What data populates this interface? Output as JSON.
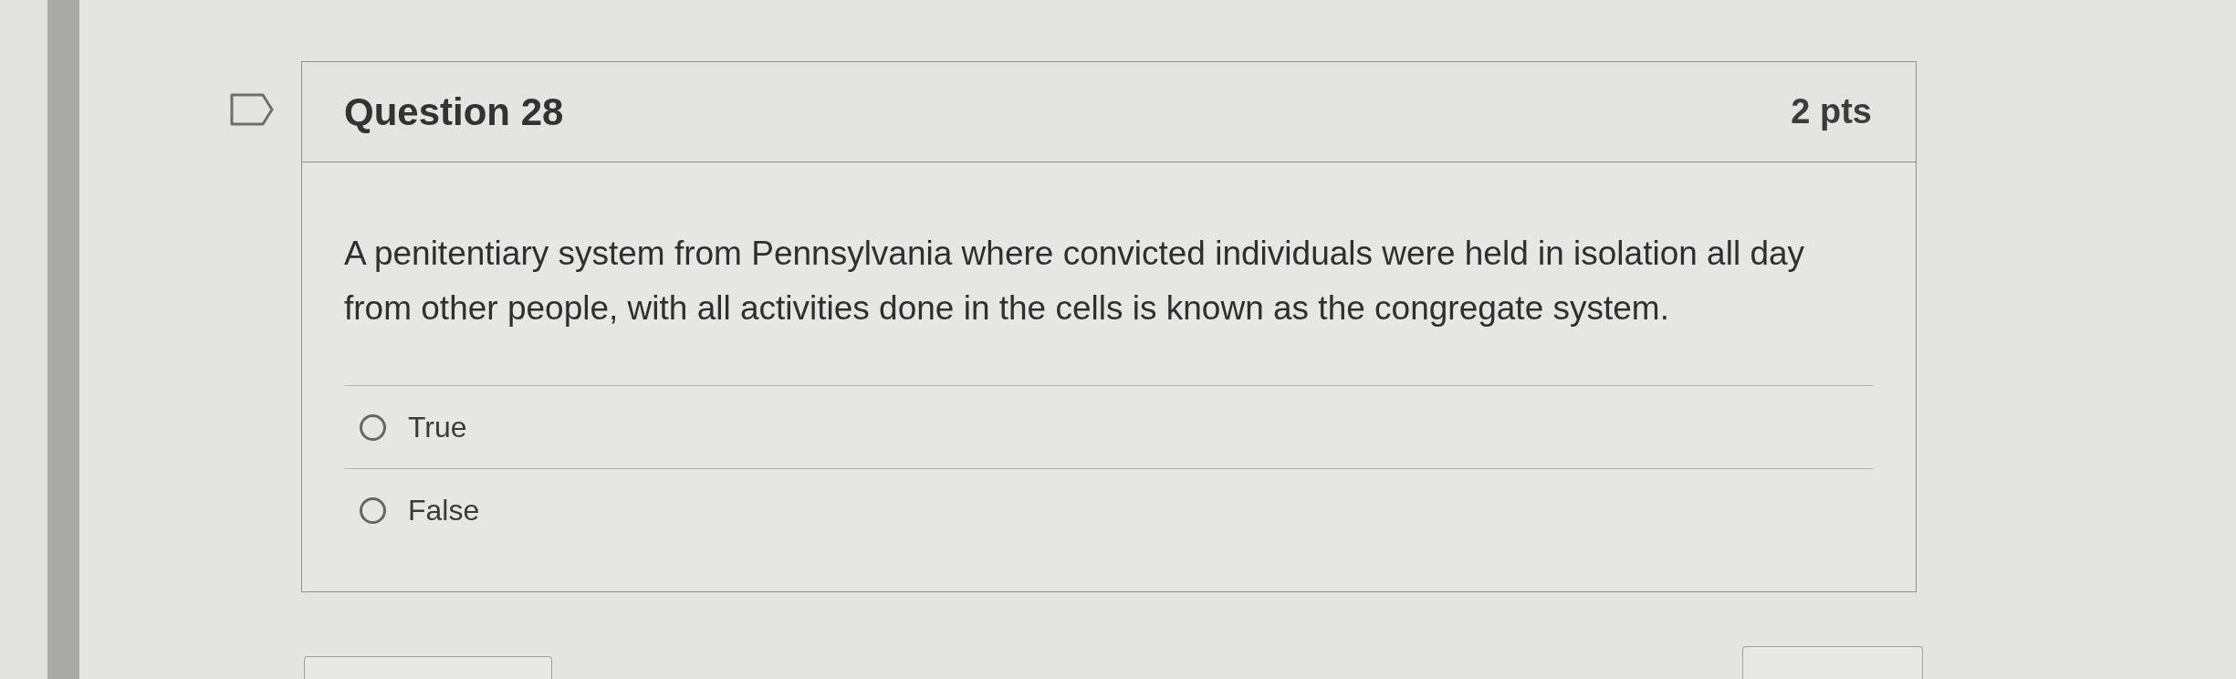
{
  "question": {
    "flagged": false,
    "title": "Question 28",
    "points": "2 pts",
    "text": "A penitentiary system from Pennsylvania where convicted individuals were held in isolation all day from other people, with all activities done in the cells is known as the congregate system.",
    "options": [
      {
        "label": "True",
        "selected": false
      },
      {
        "label": "False",
        "selected": false
      }
    ]
  }
}
